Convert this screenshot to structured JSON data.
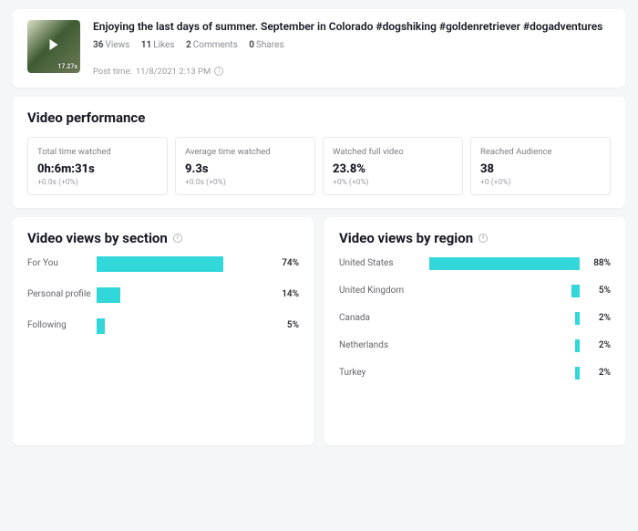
{
  "video": {
    "title": "Enjoying the last days of summer. September in Colorado #dogshiking #goldenretriever #dogadventures",
    "duration": "17.27s",
    "views_num": "36",
    "views_lbl": "Views",
    "likes_num": "11",
    "likes_lbl": "Likes",
    "comments_num": "2",
    "comments_lbl": "Comments",
    "shares_num": "0",
    "shares_lbl": "Shares",
    "post_time_prefix": "Post time:",
    "post_time": "11/8/2021 2:13 PM"
  },
  "performance": {
    "heading": "Video performance",
    "boxes": [
      {
        "label": "Total time watched",
        "value": "0h:6m:31s",
        "delta": "+0.0s (+0%)"
      },
      {
        "label": "Average time watched",
        "value": "9.3s",
        "delta": "+0.0s (+0%)"
      },
      {
        "label": "Watched full video",
        "value": "23.8%",
        "delta": "+0% (+0%)"
      },
      {
        "label": "Reached Audience",
        "value": "38",
        "delta": "+0 (+0%)"
      }
    ]
  },
  "section_chart": {
    "heading": "Video views by section",
    "rows": [
      {
        "label": "For You",
        "pct": 74
      },
      {
        "label": "Personal profile",
        "pct": 14
      },
      {
        "label": "Following",
        "pct": 5
      }
    ]
  },
  "region_chart": {
    "heading": "Video views by region",
    "rows": [
      {
        "label": "United States",
        "pct": 88
      },
      {
        "label": "United Kingdom",
        "pct": 5
      },
      {
        "label": "Canada",
        "pct": 2
      },
      {
        "label": "Netherlands",
        "pct": 2
      },
      {
        "label": "Turkey",
        "pct": 2
      }
    ]
  },
  "chart_data": [
    {
      "type": "bar",
      "title": "Video views by section",
      "categories": [
        "For You",
        "Personal profile",
        "Following"
      ],
      "values": [
        74,
        14,
        5
      ],
      "xlabel": "",
      "ylabel": "Percent",
      "ylim": [
        0,
        100
      ]
    },
    {
      "type": "bar",
      "title": "Video views by region",
      "categories": [
        "United States",
        "United Kingdom",
        "Canada",
        "Netherlands",
        "Turkey"
      ],
      "values": [
        88,
        5,
        2,
        2,
        2
      ],
      "xlabel": "",
      "ylabel": "Percent",
      "ylim": [
        0,
        100
      ]
    }
  ]
}
